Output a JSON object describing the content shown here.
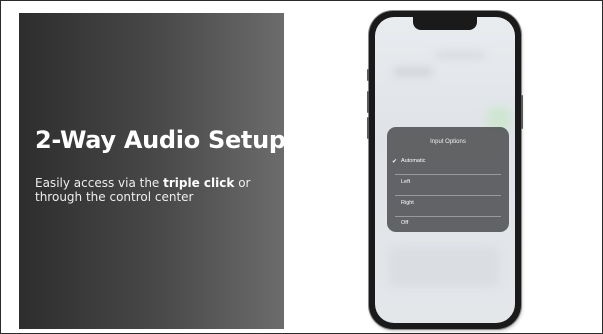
{
  "slide": {
    "heading": "2-Way Audio Setup",
    "body_prefix": "Easily access via the ",
    "body_bold": "triple click",
    "body_suffix": " or through the control center"
  },
  "phone": {
    "menu": {
      "title": "Input Options",
      "items": [
        {
          "label": "Automatic",
          "selected": true
        },
        {
          "label": "Left",
          "selected": false
        },
        {
          "label": "Right",
          "selected": false
        },
        {
          "label": "Off",
          "selected": false
        }
      ],
      "check_icon": "checkmark-icon"
    }
  }
}
